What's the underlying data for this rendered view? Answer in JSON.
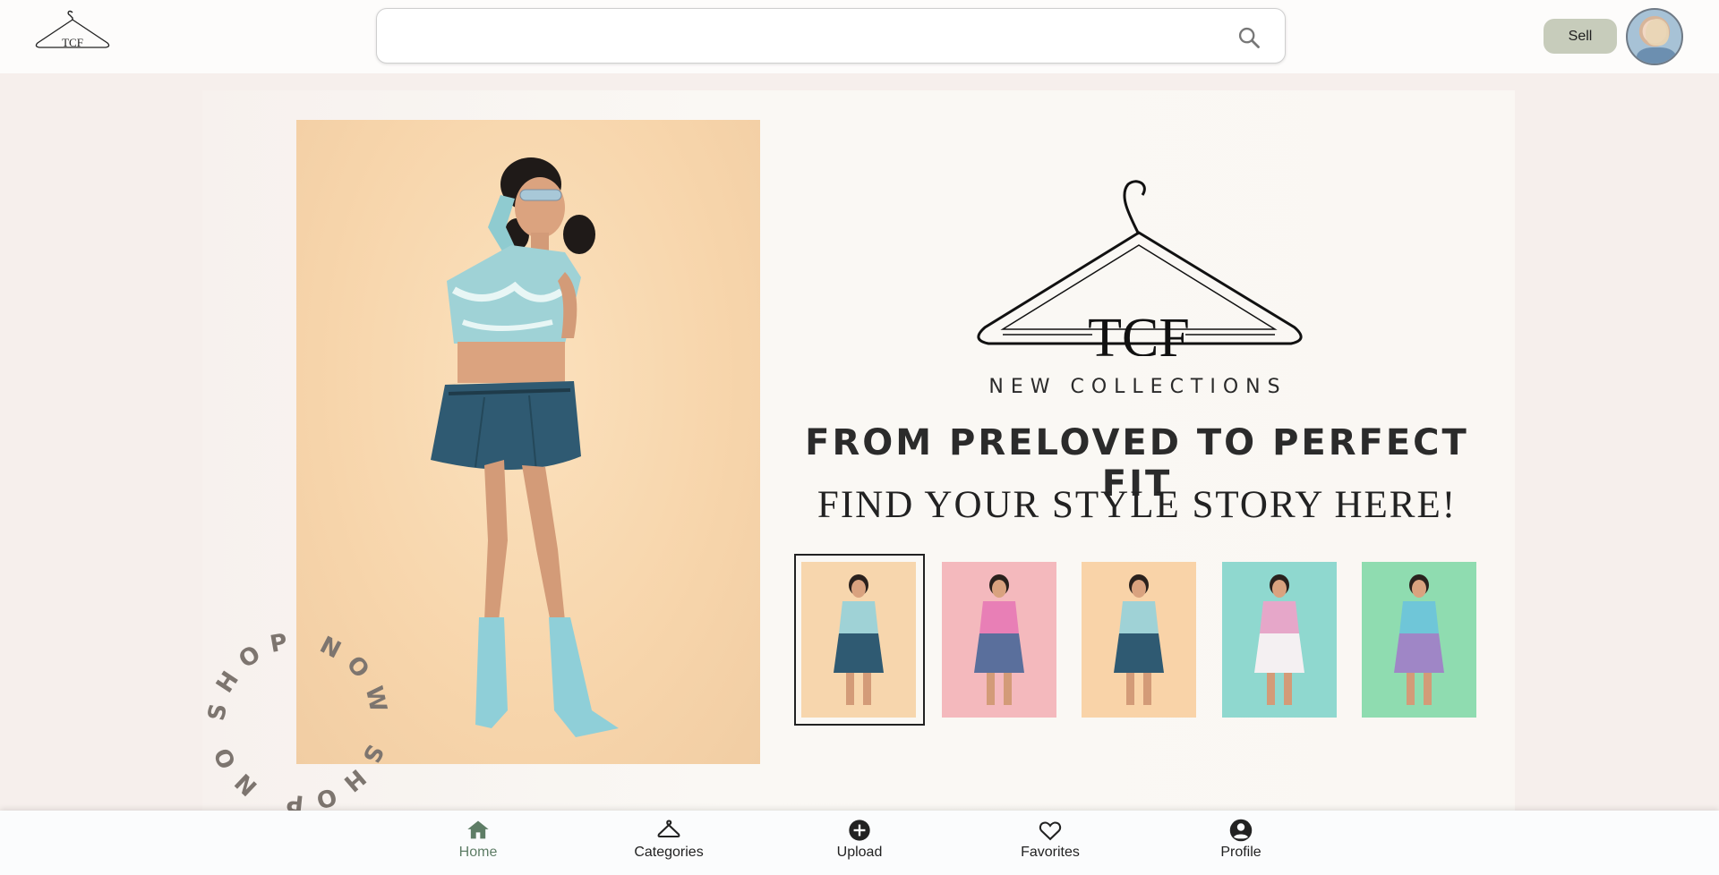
{
  "header": {
    "logo_text": "TCF",
    "search": {
      "value": "",
      "placeholder": ""
    },
    "sell_label": "Sell"
  },
  "hero": {
    "brand": "TCF",
    "tagline": "NEW COLLECTIONS",
    "headline": "FROM PRELOVED TO PERFECT FIT",
    "subheadline": "FIND YOUR STYLE STORY HERE!",
    "ring_text": "SHOP NOW SHOP NOW",
    "thumbnails": [
      {
        "bg": "#f7d6ad",
        "top": "#9fd2d6",
        "bottom": "#2f5a72",
        "selected": true
      },
      {
        "bg": "#f4b9bd",
        "top": "#e87fb6",
        "bottom": "#5a6f9c",
        "selected": false
      },
      {
        "bg": "#f9d3a8",
        "top": "#9fd2d6",
        "bottom": "#2f5a72",
        "selected": false
      },
      {
        "bg": "#8fd8cf",
        "top": "#e6a7c9",
        "bottom": "#f4f0f2",
        "selected": false
      },
      {
        "bg": "#8fdcb0",
        "top": "#6fc6d8",
        "bottom": "#9f86c6",
        "selected": false
      }
    ]
  },
  "nav": {
    "items": [
      {
        "label": "Home",
        "icon": "home-icon",
        "active": true
      },
      {
        "label": "Categories",
        "icon": "hanger-icon",
        "active": false
      },
      {
        "label": "Upload",
        "icon": "plus-circle-icon",
        "active": false
      },
      {
        "label": "Favorites",
        "icon": "heart-icon",
        "active": false
      },
      {
        "label": "Profile",
        "icon": "account-circle-icon",
        "active": false
      }
    ]
  },
  "colors": {
    "accent_green": "#5e7d66",
    "sell_button": "#c7ccbb"
  }
}
